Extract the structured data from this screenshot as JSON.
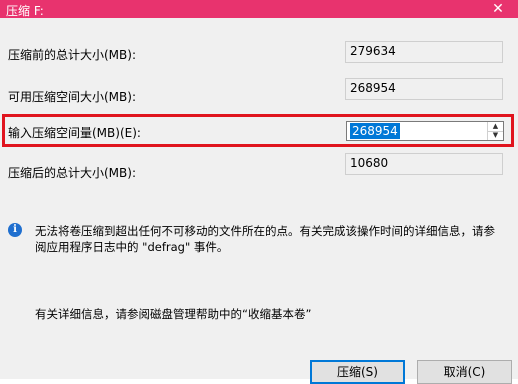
{
  "window": {
    "title": "压缩 F:",
    "close_glyph": "✕"
  },
  "fields": {
    "total_before_label": "压缩前的总计大小(MB):",
    "total_before_value": "279634",
    "available_label": "可用压缩空间大小(MB):",
    "available_value": "268954",
    "input_label": "输入压缩空间量(MB)(E):",
    "input_value": "268954",
    "total_after_label": "压缩后的总计大小(MB):",
    "total_after_value": "10680"
  },
  "info": {
    "icon": "info-icon",
    "text": "无法将卷压缩到超出任何不可移动的文件所在的点。有关完成该操作时间的详细信息，请参阅应用程序日志中的 \"defrag\" 事件。",
    "more": "有关详细信息，请参阅磁盘管理帮助中的“收缩基本卷”"
  },
  "buttons": {
    "shrink": "压缩(S)",
    "cancel": "取消(C)"
  },
  "colors": {
    "titlebar": "#e8336e",
    "highlight": "#e0141e",
    "selection": "#0078d7"
  }
}
